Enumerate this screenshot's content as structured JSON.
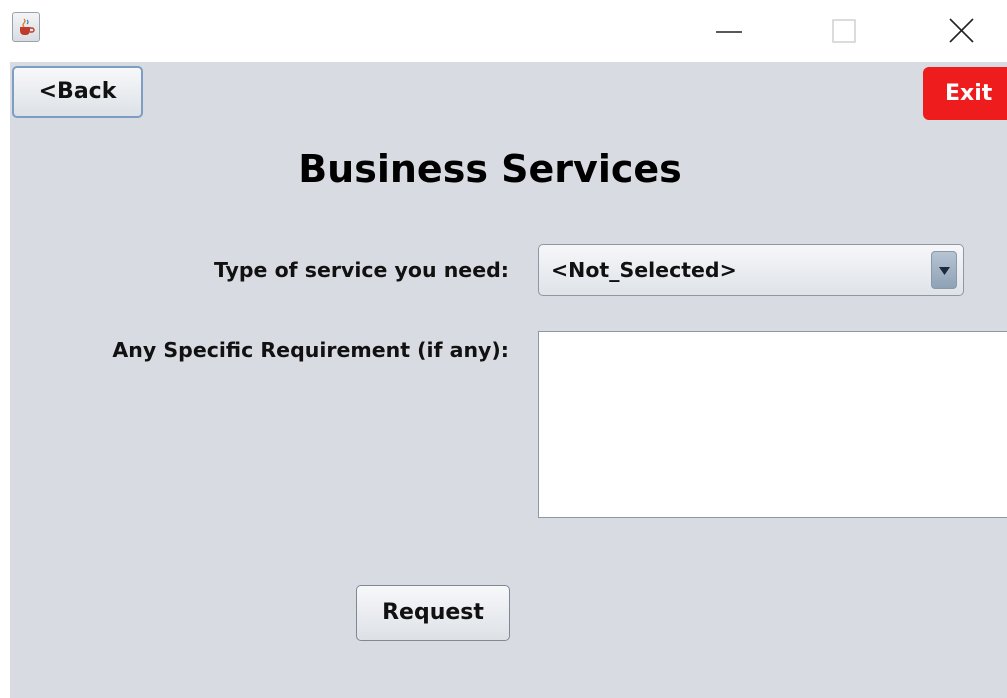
{
  "window": {
    "icon": "java-cup-icon",
    "controls": {
      "minimize": "minimize-icon",
      "maximize": "maximize-icon",
      "close": "close-icon"
    }
  },
  "toolbar": {
    "back_label": "<Back",
    "exit_label": "Exit",
    "exit_color": "#ee1c1c"
  },
  "page": {
    "title": "Business Services"
  },
  "form": {
    "service_label": "Type of service you need:",
    "service_selected": "<Not_Selected>",
    "requirement_label": "Any Specific Requirement (if any):",
    "requirement_value": "",
    "submit_label": "Request"
  },
  "colors": {
    "panel_background": "#d8dbe1",
    "exit_button": "#ee1c1c"
  }
}
